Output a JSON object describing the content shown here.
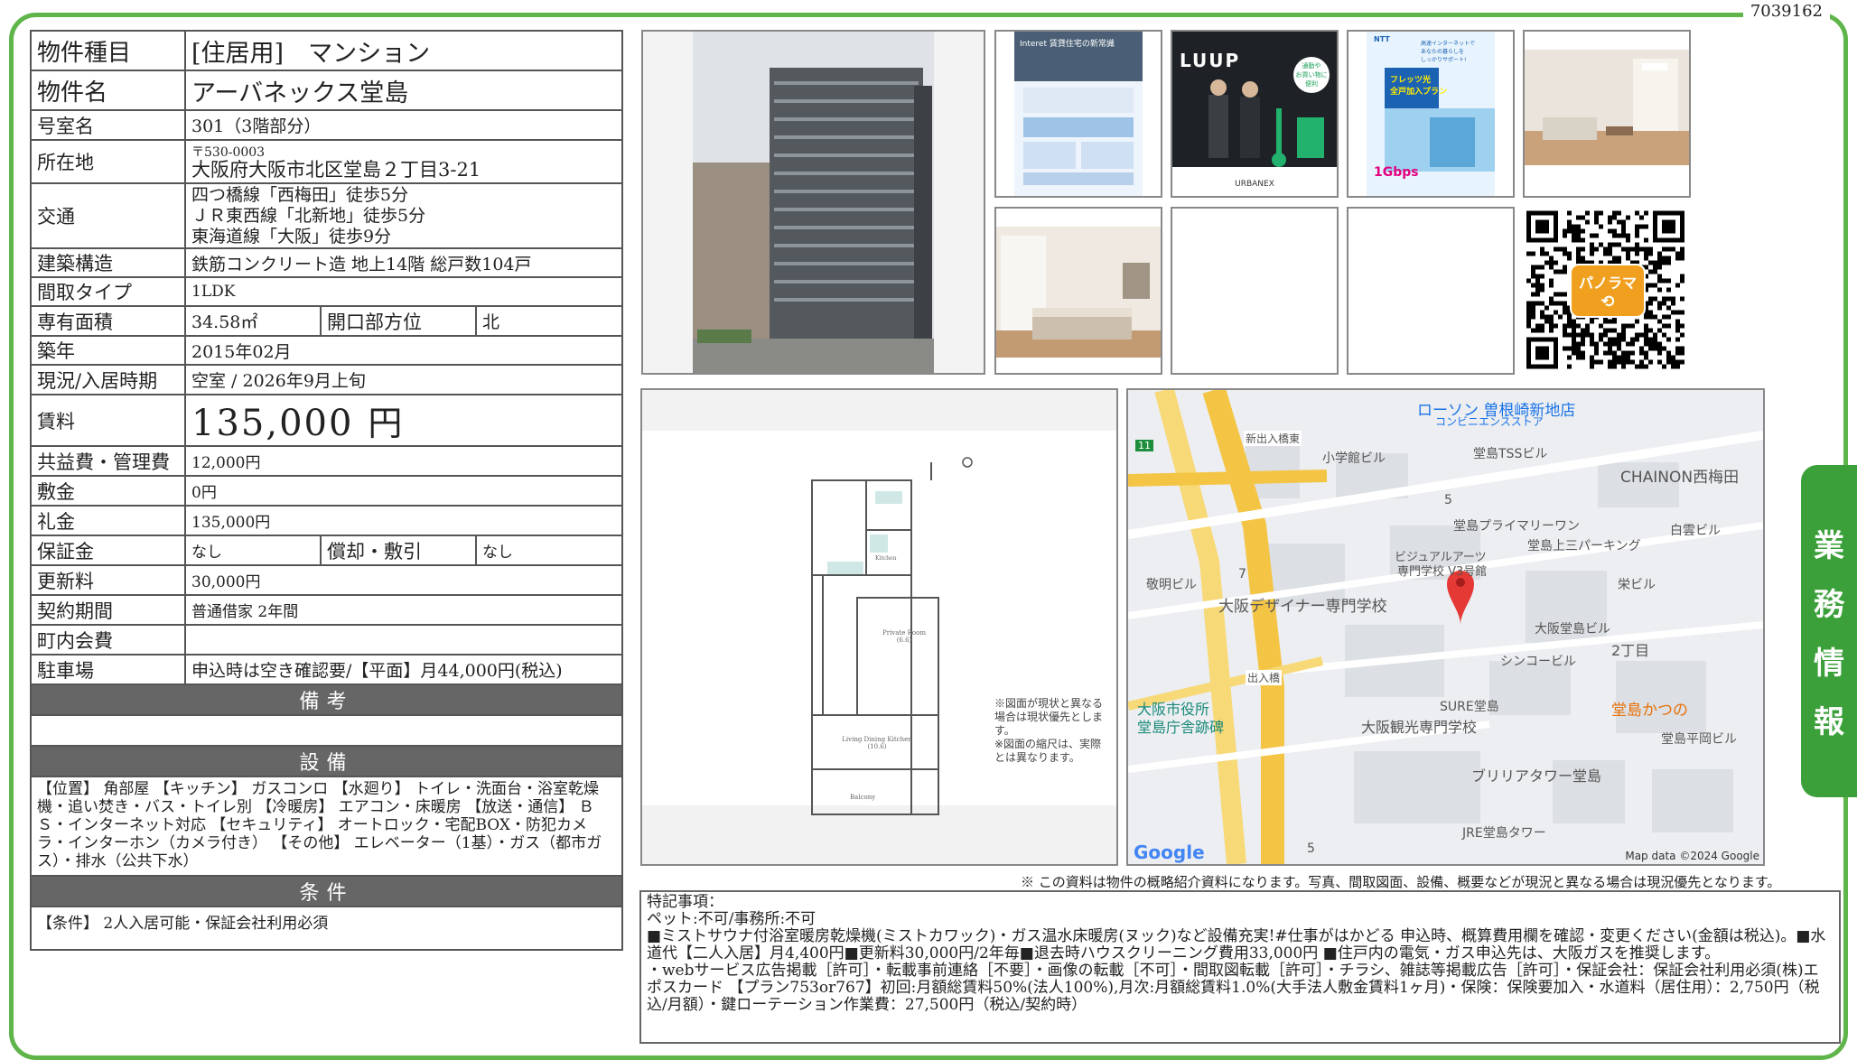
{
  "doc_id": "7039162",
  "side_tab": [
    "業",
    "務",
    "情",
    "報"
  ],
  "property": {
    "type_label": "物件種目",
    "type_value": "[住居用]　マンション",
    "name_label": "物件名",
    "name_value": "アーバネックス堂島",
    "room_label": "号室名",
    "room_value": "301（3階部分）",
    "address_label": "所在地",
    "postal": "〒530-0003",
    "address": "大阪府大阪市北区堂島２丁目3-21",
    "transport_label": "交通",
    "transport": [
      "四つ橋線「西梅田」徒歩5分",
      "ＪＲ東西線「北新地」徒歩5分",
      "東海道線「大阪」徒歩9分"
    ],
    "structure_label": "建築構造",
    "structure_value": "鉄筋コンクリート造 地上14階 総戸数104戸",
    "layout_label": "間取タイプ",
    "layout_value": "1LDK",
    "area_label": "専有面積",
    "area_value": "34.58㎡",
    "opening_label": "開口部方位",
    "opening_value": "北",
    "built_label": "築年",
    "built_value": "2015年02月",
    "status_label": "現況/入居時期",
    "status_value": "空室 / 2026年9月上旬",
    "rent_label": "賃料",
    "rent_value": "135,000",
    "rent_unit": "円",
    "fee_label": "共益費・管理費",
    "fee_value": "12,000円",
    "deposit_label": "敷金",
    "deposit_value": "0円",
    "key_money_label": "礼金",
    "key_money_value": "135,000円",
    "guarantee_label": "保証金",
    "guarantee_value": "なし",
    "amort_label": "償却・敷引",
    "amort_value": "なし",
    "renewal_label": "更新料",
    "renewal_value": "30,000円",
    "contract_label": "契約期間",
    "contract_value": "普通借家 2年間",
    "town_label": "町内会費",
    "town_value": "",
    "parking_label": "駐車場",
    "parking_value": "申込時は空き確認要/【平面】月44,000円(税込)",
    "notes_header": "備考",
    "notes_value": "",
    "equip_header": "設備",
    "equip_value": "【位置】 角部屋 【キッチン】 ガスコンロ 【水廻り】 トイレ・洗面台・浴室乾燥機・追い焚き・バス・トイレ別 【冷暖房】 エアコン・床暖房 【放送・通信】 ＢＳ・インターネット対応 【セキュリティ】 オートロック・宅配BOX・防犯カメラ・インターホン（カメラ付き） 【その他】 エレベーター（1基）・ガス（都市ガス）・排水（公共下水）",
    "cond_header": "条件",
    "cond_value": "【条件】 2人入居可能・保証会社利用必須"
  },
  "images": {
    "flyer1_title": "Interet 賃貸住宅の新常識",
    "luup_brand": "LUUP",
    "luup_caption": "URBANEX",
    "luup_bubble": "通勤や\nお買い物に\n便利",
    "ntt_brand": "NTT",
    "flets_badge": "フレッツ光\n全戸加入プラン",
    "flets_speed": "1Gbps",
    "flets_text": "高速インターネットで\nあなたの暮らしを\nしっかりサポート!",
    "panorama_label": "パノラマ"
  },
  "floorplan": {
    "note": "※図面が現状と異なる場合は現状優先とします。\n※図面の縮尺は、実際とは異なります。",
    "room_private": "Private Room\n(6.6)",
    "room_ldk": "Living Dining Kitchen\n(10.6)",
    "balcony": "Balcony",
    "kitchen": "Kitchen"
  },
  "map": {
    "labels": [
      "ローソン 曽根崎新地店",
      "コンビニエンスストア",
      "新出入橋東",
      "小学館ビル",
      "堂島TSSビル",
      "CHAINON西梅田",
      "白雲ビル",
      "堂島プライマリーワン",
      "堂島上三パーキング",
      "ビジュアルアーツ",
      "専門学校 V3号館",
      "敬明ビル",
      "栄ビル",
      "大阪デザイナー専門学校",
      "大阪堂島ビル",
      "2丁目",
      "シンコービル",
      "出入橋",
      "大阪市役所",
      "堂島庁舎跡碑",
      "SURE堂島",
      "大阪観光専門学校",
      "堂島かつの",
      "堂島平岡ビル",
      "ブリリアタワー堂島",
      "JRE堂島タワー",
      "5",
      "7",
      "11",
      "5"
    ],
    "logo": "Google",
    "attribution": "Map data ©2024 Google"
  },
  "notice": "※ この資料は物件の概略紹介資料になります。写真、間取図面、設備、概要などが現況と異なる場合は現況優先となります。",
  "remarks": {
    "lines": [
      "特記事項：",
      "ペット:不可/事務所:不可",
      "■ミストサウナ付浴室暖房乾燥機(ミストカワック)・ガス温水床暖房(ヌック)など設備充実!#仕事がはかどる 申込時、概算費用欄を確認・変更ください(金額は税込)。■水道代【二人入居】月4,400円■更新料30,000円/2年毎■退去時ハウスクリーニング費用33,000円 ■住戸内の電気・ガス申込先は、大阪ガスを推奨します。",
      "・webサービス広告掲載［許可］・転載事前連絡［不要］・画像の転載［不可］・間取図転載［許可］・チラシ、雑誌等掲載広告［許可］・保証会社：保証会社利用必須(株)エポスカード 【プラン753or767】初回:月額総賃料50%(法人100%),月次:月額総賃料1.0%(大手法人敷金賃料1ヶ月)・保険：保険要加入・水道料（居住用）：2,750円（税込/月額）・鍵ローテーション作業費：27,500円（税込/契約時）"
    ]
  }
}
